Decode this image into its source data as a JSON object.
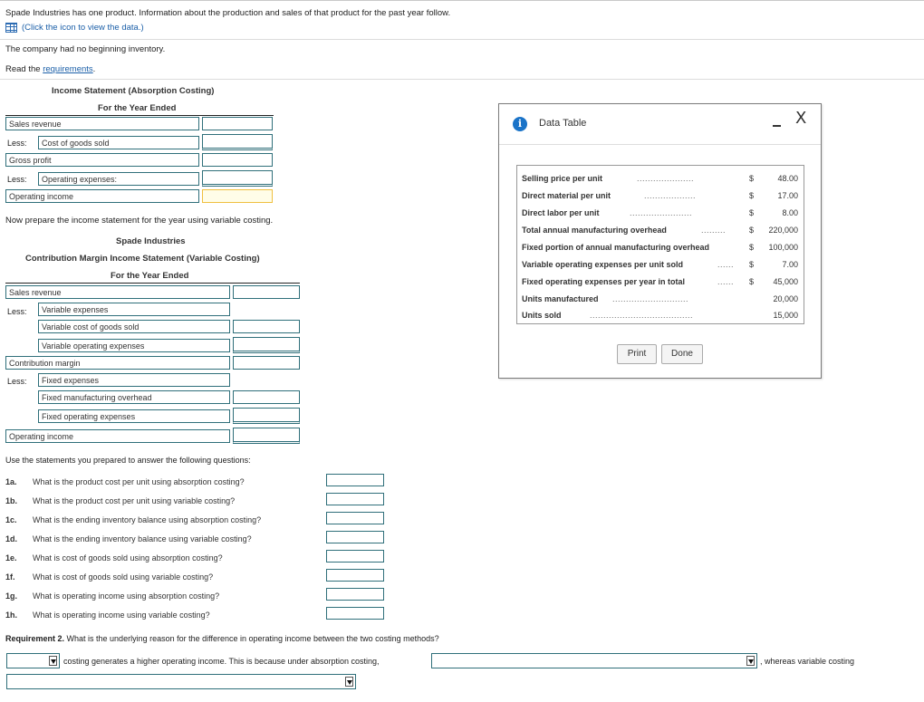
{
  "intro": {
    "text": "Spade Industries has one product. Information about the production and sales of that product for the past year follow.",
    "data_link": "(Click the icon to view the data.)",
    "no_inventory": "The company had no beginning inventory.",
    "read_prefix": "Read the ",
    "requirements_link": "requirements",
    "read_suffix": "."
  },
  "absorption": {
    "title": "Income Statement (Absorption Costing)",
    "period": "For the Year Ended",
    "sales_revenue": "Sales revenue",
    "less": "Less:",
    "cogs": "Cost of goods sold",
    "gross_profit": "Gross profit",
    "less2": "Less:",
    "operating_expenses": "Operating expenses:",
    "operating_income": "Operating income"
  },
  "variable_prompt": "Now prepare the income statement for the year using variable costing.",
  "variable": {
    "company": "Spade Industries",
    "title": "Contribution Margin Income Statement (Variable Costing)",
    "period": "For the Year Ended",
    "sales_revenue": "Sales revenue",
    "less": "Less:",
    "variable_expenses": "Variable expenses",
    "variable_cogs": "Variable cost of goods sold",
    "variable_opex": "Variable operating expenses",
    "contribution_margin": "Contribution margin",
    "less2": "Less:",
    "fixed_expenses": "Fixed expenses",
    "fixed_moh": "Fixed manufacturing overhead",
    "fixed_opex": "Fixed operating expenses",
    "operating_income": "Operating income"
  },
  "questions": {
    "intro": "Use the statements you prepared to answer the following questions:",
    "items": [
      {
        "num": "1a.",
        "text": "What is the product cost per unit using absorption costing?"
      },
      {
        "num": "1b.",
        "text": "What is the product cost per unit using variable costing?"
      },
      {
        "num": "1c.",
        "text": "What is the ending inventory balance using absorption costing?"
      },
      {
        "num": "1d.",
        "text": "What is the ending inventory balance using variable costing?"
      },
      {
        "num": "1e.",
        "text": "What is cost of goods sold using absorption costing?"
      },
      {
        "num": "1f.",
        "text": "What is cost of goods sold using variable costing?"
      },
      {
        "num": "1g.",
        "text": "What is operating income using absorption costing?"
      },
      {
        "num": "1h.",
        "text": "What is operating income using variable costing?"
      }
    ]
  },
  "requirement2": {
    "label": "Requirement 2.",
    "text": " What is the underlying reason for the difference in operating income between the two costing methods?",
    "sentence_mid": "costing generates a higher operating income. This is because under absorption costing,",
    "sentence_end": ", whereas variable costing"
  },
  "dialog": {
    "icon": "i",
    "title": "Data Table",
    "minimize_icon": "minimize-icon",
    "close": "X",
    "rows": [
      {
        "label": "Selling price per unit",
        "dots": ".....................",
        "cur": "$",
        "value": "48.00"
      },
      {
        "label": "Direct material per unit",
        "dots": "...................",
        "cur": "$",
        "value": "17.00"
      },
      {
        "label": "Direct labor per unit",
        "dots": ".......................",
        "cur": "$",
        "value": "8.00"
      },
      {
        "label": "Total annual manufacturing overhead",
        "dots": ".........",
        "cur": "$",
        "value": "220,000"
      },
      {
        "label": "Fixed portion of annual manufacturing overhead",
        "dots": "",
        "cur": "$",
        "value": "100,000"
      },
      {
        "label": "Variable operating expenses per unit sold",
        "dots": "......",
        "cur": "$",
        "value": "7.00"
      },
      {
        "label": "Fixed operating expenses per year in total",
        "dots": "......",
        "cur": "$",
        "value": "45,000"
      },
      {
        "label": "Units manufactured",
        "dots": "............................",
        "cur": "",
        "value": "20,000"
      },
      {
        "label": "Units sold",
        "dots": "......................................",
        "cur": "",
        "value": "15,000"
      }
    ],
    "print": "Print",
    "done": "Done"
  }
}
